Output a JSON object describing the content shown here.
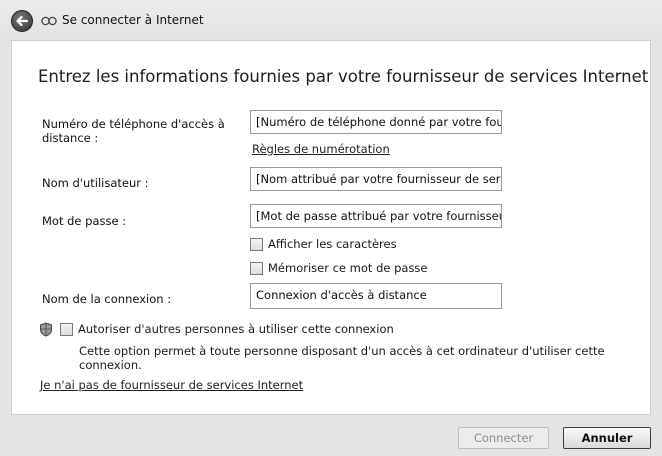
{
  "window": {
    "title": "Se connecter à Internet"
  },
  "main": {
    "heading": "Entrez les informations fournies par votre fournisseur de services Internet",
    "phone": {
      "label_line1": "Numéro de téléphone d'accès à",
      "label_line2": "distance :",
      "value": "[Numéro de téléphone donné par votre fou",
      "dialing_rules_link": "Règles de numérotation"
    },
    "username": {
      "label": "Nom d'utilisateur :",
      "value": "[Nom attribué par votre fournisseur de serv"
    },
    "password": {
      "label": "Mot de passe :",
      "value": "[Mot de passe attribué par votre fournisseu",
      "show_chars_label": "Afficher les caractères",
      "remember_label": "Mémoriser ce mot de passe"
    },
    "connection_name": {
      "label": "Nom de la connexion :",
      "value": "Connexion d'accès à distance"
    },
    "allow_others": {
      "label": "Autoriser d'autres personnes à utiliser cette connexion",
      "description_line1": "Cette option permet à toute personne disposant d'un accès à cet ordinateur d'utiliser cette",
      "description_line2": "connexion."
    },
    "no_isp_link": "Je n'ai pas de fournisseur de services Internet"
  },
  "footer": {
    "connect_label": "Connecter",
    "cancel_label": "Annuler"
  },
  "icons": {
    "back": "back-arrow-icon",
    "network": "network-connection-icon",
    "shield": "uac-shield-icon"
  },
  "colors": {
    "background": "#e4e4e4",
    "content": "#ffffff",
    "text": "#1a1a1a"
  }
}
